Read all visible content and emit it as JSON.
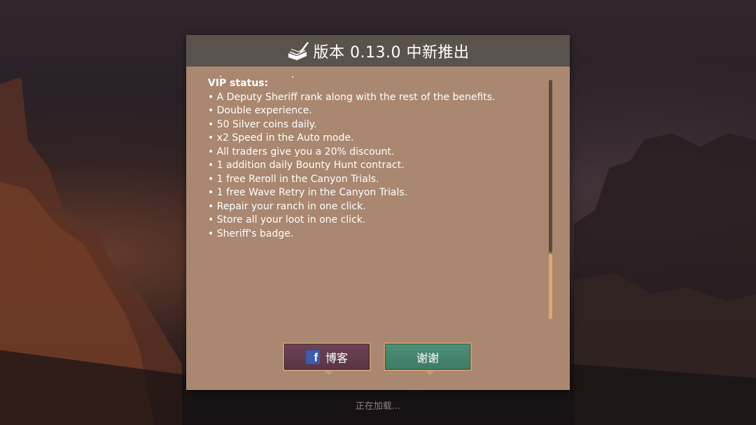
{
  "dialog": {
    "title": "版本 0.13.0 中新推出",
    "title_icon": "book-quill-icon",
    "vip_heading": "VIP status:",
    "vip_items": [
      "A Deputy Sheriff rank along with the rest of the benefits.",
      "Double experience.",
      "50 Silver coins daily.",
      "x2 Speed in the Auto mode.",
      "All traders give you a 20% discount.",
      "1 addition daily Bounty Hunt contract.",
      "1 free Reroll in the Canyon Trials.",
      "1 free Wave Retry in the Canyon Trials.",
      "Repair your ranch in one click.",
      "Store all your loot in one click.",
      "Sheriff's badge."
    ],
    "blog_button_label": "博客",
    "blog_button_icon": "facebook-icon",
    "thanks_button_label": "谢谢",
    "scroll_position": 0.72
  },
  "loading_text": "正在加载...",
  "colors": {
    "header": "#5a524c",
    "panel": "#a98770",
    "blog_button": "#5a3446",
    "thanks_button": "#3f7a66",
    "button_border": "#c79a6e"
  }
}
